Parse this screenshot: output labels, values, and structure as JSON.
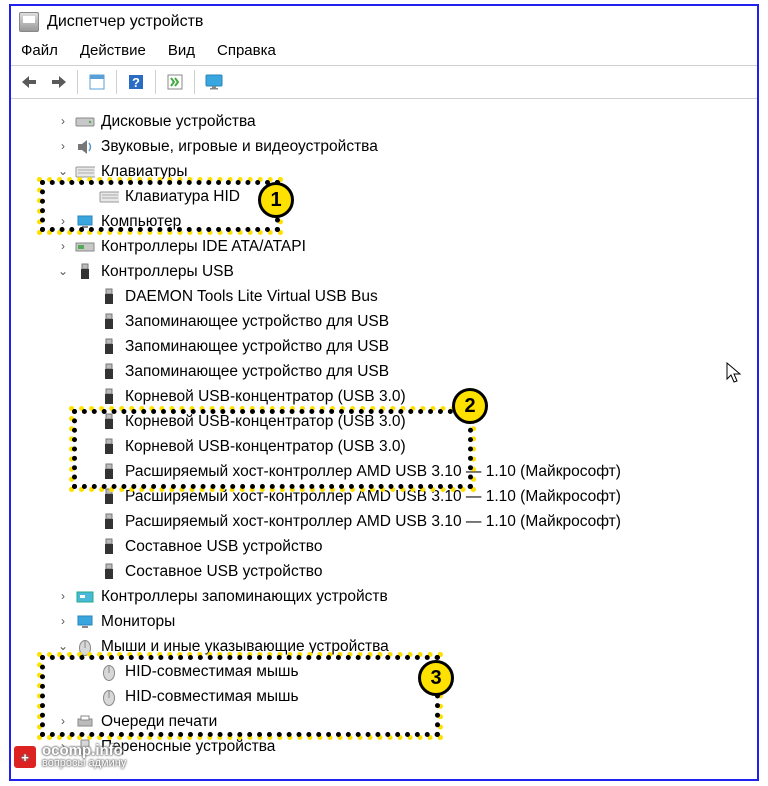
{
  "window": {
    "title": "Диспетчер устройств"
  },
  "menu": {
    "file": "Файл",
    "action": "Действие",
    "view": "Вид",
    "help": "Справка"
  },
  "tree": {
    "disk": "Дисковые устройства",
    "sound": "Звуковые, игровые и видеоустройства",
    "keyboards": "Клавиатуры",
    "keyboard_hid": "Клавиатура HID",
    "computer": "Компьютер",
    "ide": "Контроллеры IDE ATA/ATAPI",
    "usb_ctrl": "Контроллеры USB",
    "usb_items": [
      "DAEMON Tools Lite Virtual USB Bus",
      "Запоминающее устройство для USB",
      "Запоминающее устройство для USB",
      "Запоминающее устройство для USB",
      "Корневой USB-концентратор (USB 3.0)",
      "Корневой USB-концентратор (USB 3.0)",
      "Корневой USB-концентратор (USB 3.0)",
      "Расширяемый хост-контроллер AMD USB 3.10 — 1.10 (Майкрософт)",
      "Расширяемый хост-контроллер AMD USB 3.10 — 1.10 (Майкрософт)",
      "Расширяемый хост-контроллер AMD USB 3.10 — 1.10 (Майкрософт)",
      "Составное USB устройство",
      "Составное USB устройство"
    ],
    "storage_ctrl": "Контроллеры запоминающих устройств",
    "monitors": "Мониторы",
    "mice": "Мыши и иные указывающие устройства",
    "mouse_hid1": "HID-совместимая мышь",
    "mouse_hid2": "HID-совместимая мышь",
    "print_q": "Очереди печати",
    "portable": "Переносные устройства"
  },
  "callouts": {
    "n1": "1",
    "n2": "2",
    "n3": "3"
  },
  "watermark": {
    "name": "ocomp.info",
    "tag": "вопросы админу"
  }
}
